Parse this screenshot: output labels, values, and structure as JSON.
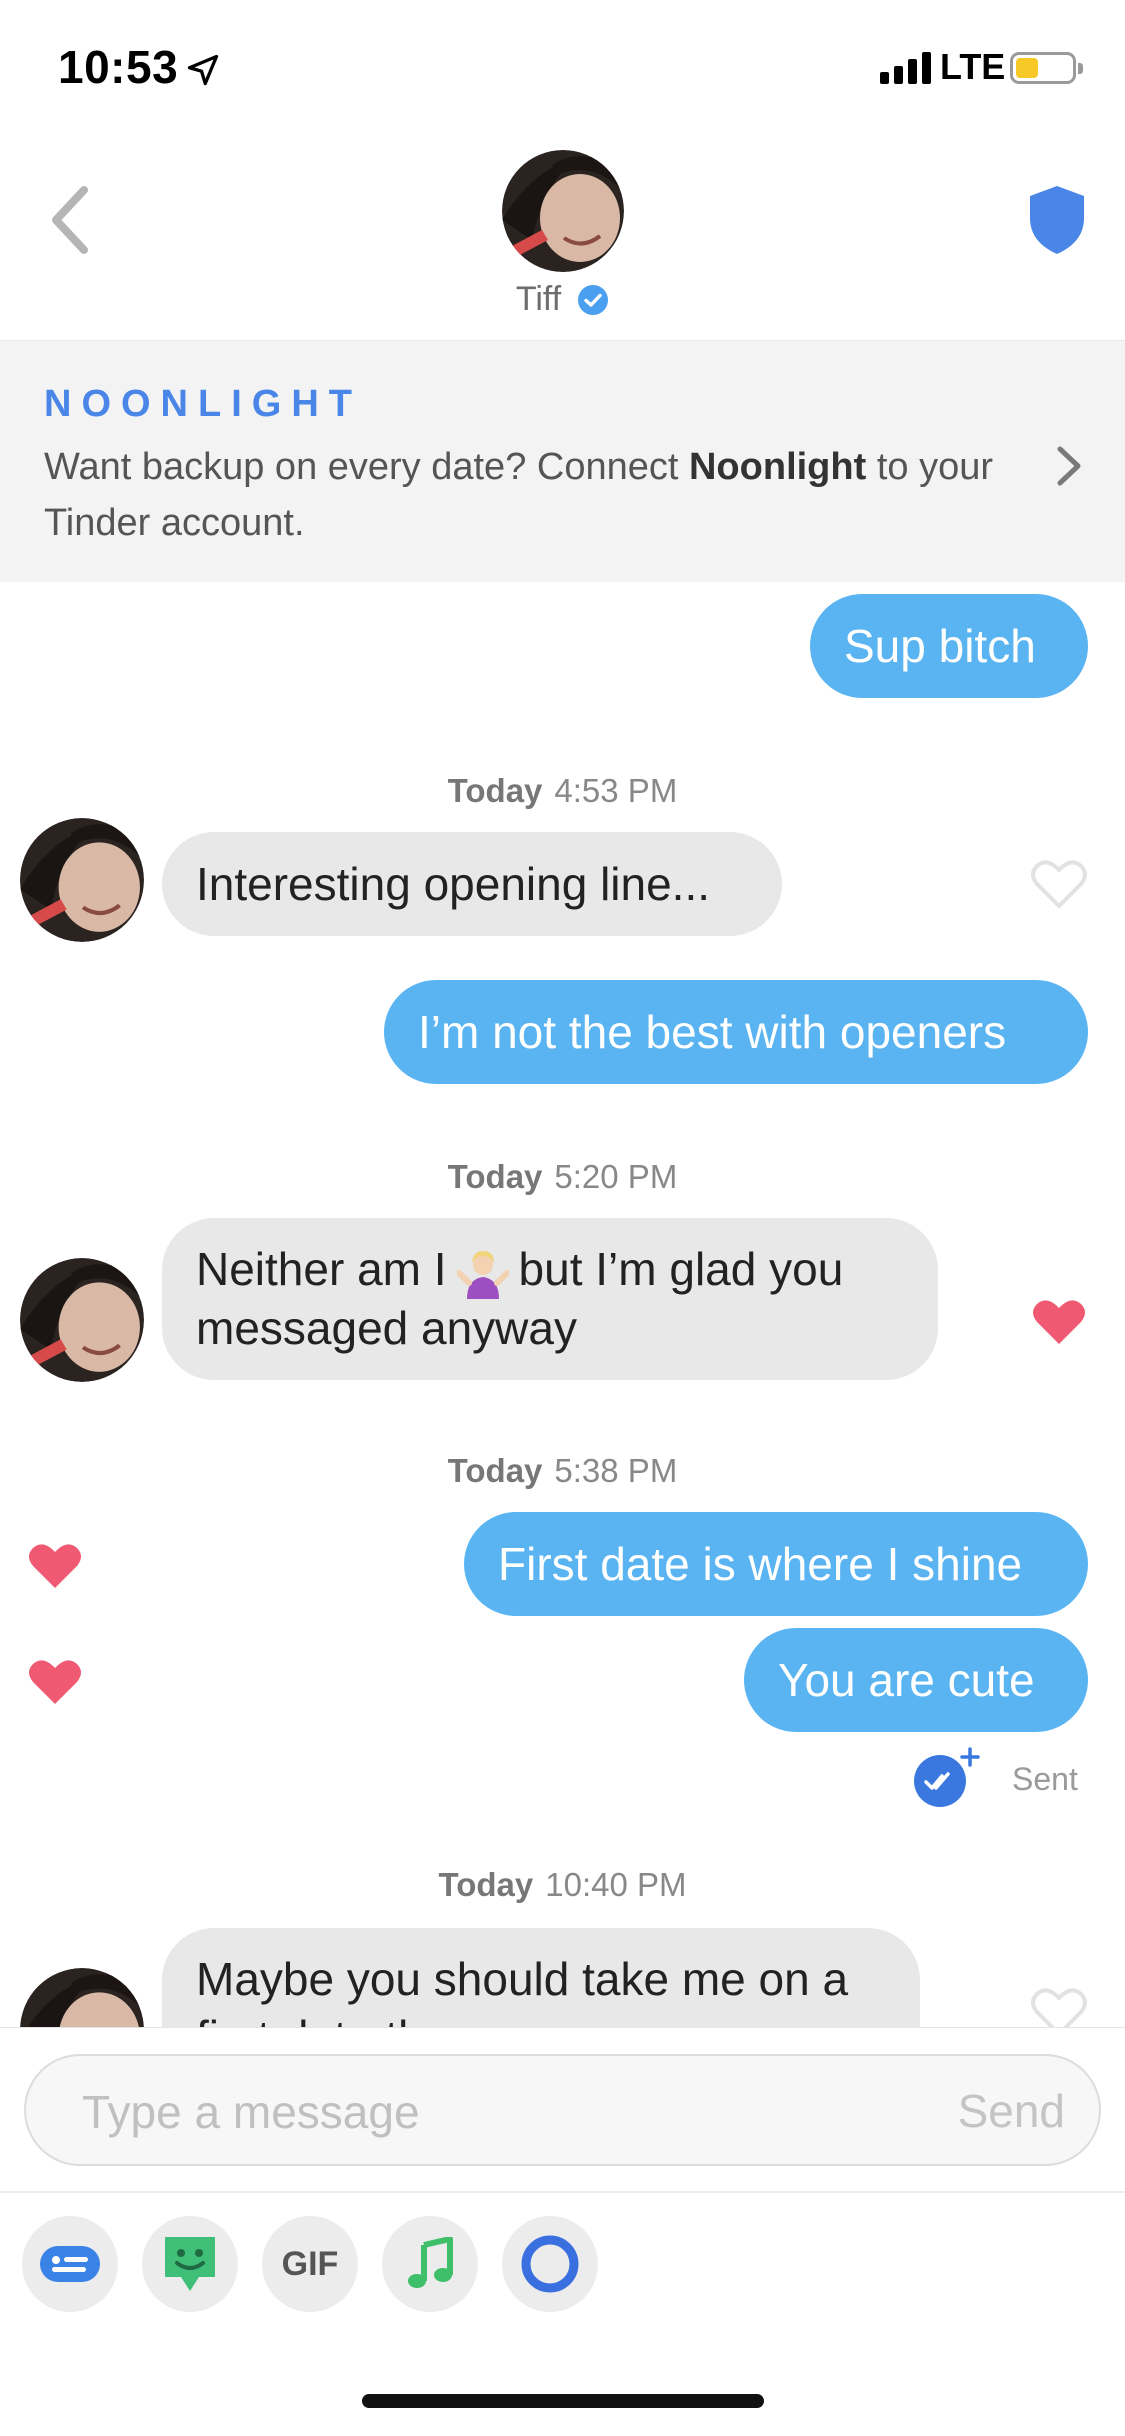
{
  "status_bar": {
    "time": "10:53",
    "network": "LTE"
  },
  "header": {
    "contact_name": "Tiff"
  },
  "banner": {
    "logo": "NOONLIGHT",
    "text_before": "Want backup on every date? Connect ",
    "text_bold": "Noonlight",
    "text_after": " to your Tinder account."
  },
  "messages": [
    {
      "direction": "outgoing",
      "text": "Sup bitch"
    },
    {
      "timestamp_day": "Today",
      "timestamp_time": "4:53 PM"
    },
    {
      "direction": "incoming",
      "text": "Interesting opening line...",
      "liked": false
    },
    {
      "direction": "outgoing",
      "text": "I’m not the best with openers"
    },
    {
      "timestamp_day": "Today",
      "timestamp_time": "5:20 PM"
    },
    {
      "direction": "incoming",
      "text_before_emoji": "Neither am I",
      "text_after_emoji": "but I’m glad you messaged anyway",
      "liked": true
    },
    {
      "timestamp_day": "Today",
      "timestamp_time": "5:38 PM"
    },
    {
      "direction": "outgoing",
      "text": "First date is where I shine",
      "liked": true
    },
    {
      "direction": "outgoing",
      "text": "You are cute",
      "liked": true,
      "status": "Sent"
    },
    {
      "timestamp_day": "Today",
      "timestamp_time": "10:40 PM"
    },
    {
      "direction": "incoming",
      "text": "Maybe you should take me on a first date then",
      "liked": false
    }
  ],
  "composer": {
    "placeholder": "Type a message",
    "send_label": "Send"
  },
  "tools": {
    "gif_label": "GIF"
  },
  "colors": {
    "outgoing_bubble": "#5ab4f2",
    "incoming_bubble": "#e8e8e8",
    "heart_liked": "#ef5a72",
    "accent_blue": "#4a86e8"
  }
}
